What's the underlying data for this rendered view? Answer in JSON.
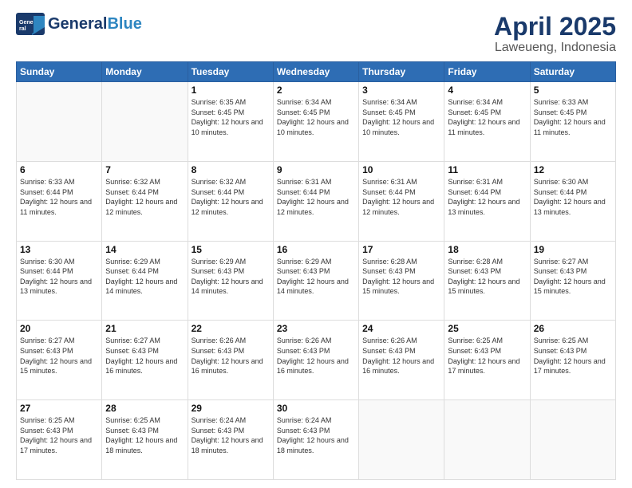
{
  "logo": {
    "line1": "General",
    "line2": "Blue"
  },
  "title": "April 2025",
  "subtitle": "Laweueng, Indonesia",
  "days_header": [
    "Sunday",
    "Monday",
    "Tuesday",
    "Wednesday",
    "Thursday",
    "Friday",
    "Saturday"
  ],
  "weeks": [
    [
      {
        "day": "",
        "sunrise": "",
        "sunset": "",
        "daylight": ""
      },
      {
        "day": "",
        "sunrise": "",
        "sunset": "",
        "daylight": ""
      },
      {
        "day": "1",
        "sunrise": "Sunrise: 6:35 AM",
        "sunset": "Sunset: 6:45 PM",
        "daylight": "Daylight: 12 hours and 10 minutes."
      },
      {
        "day": "2",
        "sunrise": "Sunrise: 6:34 AM",
        "sunset": "Sunset: 6:45 PM",
        "daylight": "Daylight: 12 hours and 10 minutes."
      },
      {
        "day": "3",
        "sunrise": "Sunrise: 6:34 AM",
        "sunset": "Sunset: 6:45 PM",
        "daylight": "Daylight: 12 hours and 10 minutes."
      },
      {
        "day": "4",
        "sunrise": "Sunrise: 6:34 AM",
        "sunset": "Sunset: 6:45 PM",
        "daylight": "Daylight: 12 hours and 11 minutes."
      },
      {
        "day": "5",
        "sunrise": "Sunrise: 6:33 AM",
        "sunset": "Sunset: 6:45 PM",
        "daylight": "Daylight: 12 hours and 11 minutes."
      }
    ],
    [
      {
        "day": "6",
        "sunrise": "Sunrise: 6:33 AM",
        "sunset": "Sunset: 6:44 PM",
        "daylight": "Daylight: 12 hours and 11 minutes."
      },
      {
        "day": "7",
        "sunrise": "Sunrise: 6:32 AM",
        "sunset": "Sunset: 6:44 PM",
        "daylight": "Daylight: 12 hours and 12 minutes."
      },
      {
        "day": "8",
        "sunrise": "Sunrise: 6:32 AM",
        "sunset": "Sunset: 6:44 PM",
        "daylight": "Daylight: 12 hours and 12 minutes."
      },
      {
        "day": "9",
        "sunrise": "Sunrise: 6:31 AM",
        "sunset": "Sunset: 6:44 PM",
        "daylight": "Daylight: 12 hours and 12 minutes."
      },
      {
        "day": "10",
        "sunrise": "Sunrise: 6:31 AM",
        "sunset": "Sunset: 6:44 PM",
        "daylight": "Daylight: 12 hours and 12 minutes."
      },
      {
        "day": "11",
        "sunrise": "Sunrise: 6:31 AM",
        "sunset": "Sunset: 6:44 PM",
        "daylight": "Daylight: 12 hours and 13 minutes."
      },
      {
        "day": "12",
        "sunrise": "Sunrise: 6:30 AM",
        "sunset": "Sunset: 6:44 PM",
        "daylight": "Daylight: 12 hours and 13 minutes."
      }
    ],
    [
      {
        "day": "13",
        "sunrise": "Sunrise: 6:30 AM",
        "sunset": "Sunset: 6:44 PM",
        "daylight": "Daylight: 12 hours and 13 minutes."
      },
      {
        "day": "14",
        "sunrise": "Sunrise: 6:29 AM",
        "sunset": "Sunset: 6:44 PM",
        "daylight": "Daylight: 12 hours and 14 minutes."
      },
      {
        "day": "15",
        "sunrise": "Sunrise: 6:29 AM",
        "sunset": "Sunset: 6:43 PM",
        "daylight": "Daylight: 12 hours and 14 minutes."
      },
      {
        "day": "16",
        "sunrise": "Sunrise: 6:29 AM",
        "sunset": "Sunset: 6:43 PM",
        "daylight": "Daylight: 12 hours and 14 minutes."
      },
      {
        "day": "17",
        "sunrise": "Sunrise: 6:28 AM",
        "sunset": "Sunset: 6:43 PM",
        "daylight": "Daylight: 12 hours and 15 minutes."
      },
      {
        "day": "18",
        "sunrise": "Sunrise: 6:28 AM",
        "sunset": "Sunset: 6:43 PM",
        "daylight": "Daylight: 12 hours and 15 minutes."
      },
      {
        "day": "19",
        "sunrise": "Sunrise: 6:27 AM",
        "sunset": "Sunset: 6:43 PM",
        "daylight": "Daylight: 12 hours and 15 minutes."
      }
    ],
    [
      {
        "day": "20",
        "sunrise": "Sunrise: 6:27 AM",
        "sunset": "Sunset: 6:43 PM",
        "daylight": "Daylight: 12 hours and 15 minutes."
      },
      {
        "day": "21",
        "sunrise": "Sunrise: 6:27 AM",
        "sunset": "Sunset: 6:43 PM",
        "daylight": "Daylight: 12 hours and 16 minutes."
      },
      {
        "day": "22",
        "sunrise": "Sunrise: 6:26 AM",
        "sunset": "Sunset: 6:43 PM",
        "daylight": "Daylight: 12 hours and 16 minutes."
      },
      {
        "day": "23",
        "sunrise": "Sunrise: 6:26 AM",
        "sunset": "Sunset: 6:43 PM",
        "daylight": "Daylight: 12 hours and 16 minutes."
      },
      {
        "day": "24",
        "sunrise": "Sunrise: 6:26 AM",
        "sunset": "Sunset: 6:43 PM",
        "daylight": "Daylight: 12 hours and 16 minutes."
      },
      {
        "day": "25",
        "sunrise": "Sunrise: 6:25 AM",
        "sunset": "Sunset: 6:43 PM",
        "daylight": "Daylight: 12 hours and 17 minutes."
      },
      {
        "day": "26",
        "sunrise": "Sunrise: 6:25 AM",
        "sunset": "Sunset: 6:43 PM",
        "daylight": "Daylight: 12 hours and 17 minutes."
      }
    ],
    [
      {
        "day": "27",
        "sunrise": "Sunrise: 6:25 AM",
        "sunset": "Sunset: 6:43 PM",
        "daylight": "Daylight: 12 hours and 17 minutes."
      },
      {
        "day": "28",
        "sunrise": "Sunrise: 6:25 AM",
        "sunset": "Sunset: 6:43 PM",
        "daylight": "Daylight: 12 hours and 18 minutes."
      },
      {
        "day": "29",
        "sunrise": "Sunrise: 6:24 AM",
        "sunset": "Sunset: 6:43 PM",
        "daylight": "Daylight: 12 hours and 18 minutes."
      },
      {
        "day": "30",
        "sunrise": "Sunrise: 6:24 AM",
        "sunset": "Sunset: 6:43 PM",
        "daylight": "Daylight: 12 hours and 18 minutes."
      },
      {
        "day": "",
        "sunrise": "",
        "sunset": "",
        "daylight": ""
      },
      {
        "day": "",
        "sunrise": "",
        "sunset": "",
        "daylight": ""
      },
      {
        "day": "",
        "sunrise": "",
        "sunset": "",
        "daylight": ""
      }
    ]
  ]
}
